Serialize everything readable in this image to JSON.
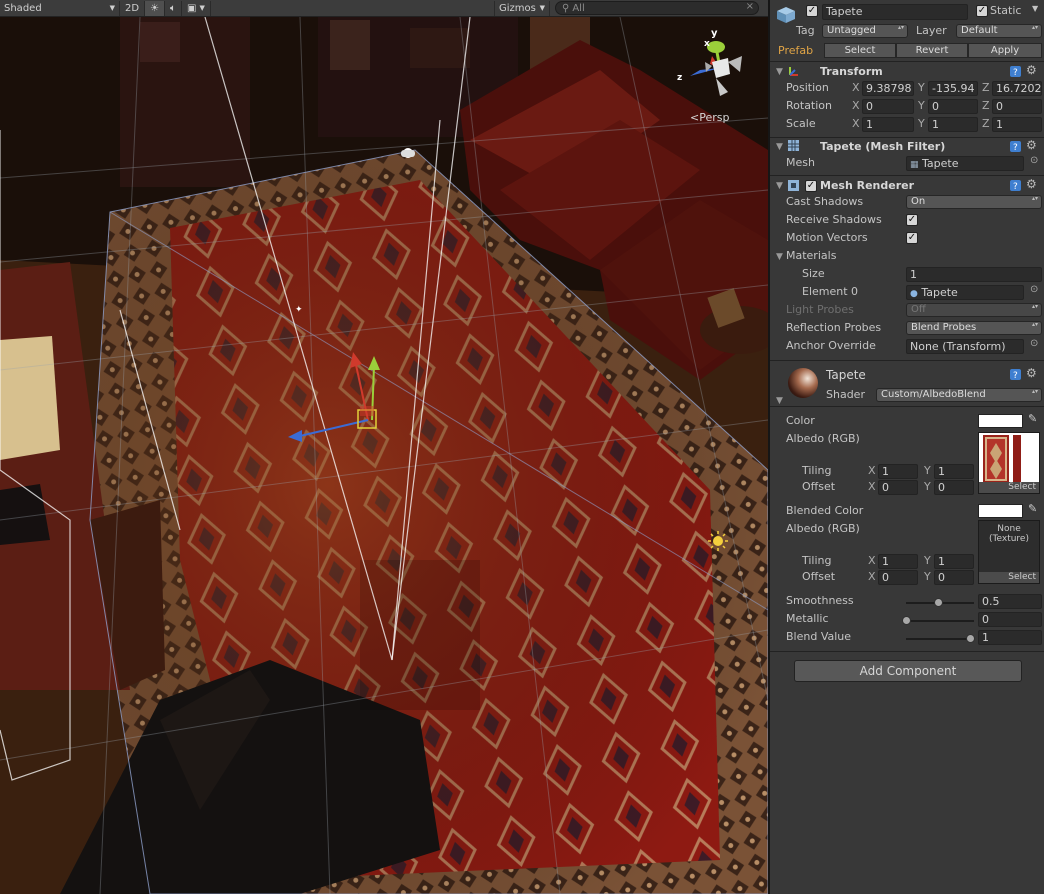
{
  "scene_toolbar": {
    "shading": "Shaded",
    "mode2d": "2D",
    "gizmos": "Gizmos",
    "search_placeholder": "All"
  },
  "scene": {
    "projection": "Persp"
  },
  "inspector": {
    "object_name": "Tapete",
    "static_label": "Static",
    "tag_label": "Tag",
    "tag_value": "Untagged",
    "layer_label": "Layer",
    "layer_value": "Default",
    "prefab_label": "Prefab",
    "prefab_select": "Select",
    "prefab_revert": "Revert",
    "prefab_apply": "Apply",
    "transform": {
      "title": "Transform",
      "position_label": "Position",
      "pos_x": "9.38798",
      "pos_y": "-135.94",
      "pos_z": "16.7202",
      "rotation_label": "Rotation",
      "rot_x": "0",
      "rot_y": "0",
      "rot_z": "0",
      "scale_label": "Scale",
      "sc_x": "1",
      "sc_y": "1",
      "sc_z": "1",
      "x": "X",
      "y": "Y",
      "z": "Z"
    },
    "mesh_filter": {
      "title": "Tapete (Mesh Filter)",
      "mesh_label": "Mesh",
      "mesh_value": "Tapete"
    },
    "mesh_renderer": {
      "title": "Mesh Renderer",
      "cast_shadows_label": "Cast Shadows",
      "cast_shadows_value": "On",
      "receive_shadows_label": "Receive Shadows",
      "motion_vectors_label": "Motion Vectors",
      "materials_label": "Materials",
      "size_label": "Size",
      "size_value": "1",
      "element0_label": "Element 0",
      "element0_value": "Tapete",
      "light_probes_label": "Light Probes",
      "light_probes_value": "Off",
      "reflection_probes_label": "Reflection Probes",
      "reflection_probes_value": "Blend Probes",
      "anchor_override_label": "Anchor Override",
      "anchor_override_value": "None (Transform)"
    },
    "material": {
      "name": "Tapete",
      "shader_label": "Shader",
      "shader_value": "Custom/AlbedoBlend",
      "color_label": "Color",
      "albedo_label": "Albedo (RGB)",
      "tiling_label": "Tiling",
      "offset_label": "Offset",
      "tiling_x": "1",
      "tiling_y": "1",
      "offset_x": "0",
      "offset_y": "0",
      "select_label": "Select",
      "blended_color_label": "Blended Color",
      "albedo2_label": "Albedo (RGB)",
      "none_texture_line1": "None",
      "none_texture_line2": "(Texture)",
      "tiling2_x": "1",
      "tiling2_y": "1",
      "offset2_x": "0",
      "offset2_y": "0",
      "smoothness_label": "Smoothness",
      "smoothness_value": "0.5",
      "smoothness": 0.5,
      "metallic_label": "Metallic",
      "metallic_value": "0",
      "metallic": 0,
      "blend_label": "Blend Value",
      "blend_value": "1",
      "blend": 1
    },
    "add_component": "Add Component"
  }
}
